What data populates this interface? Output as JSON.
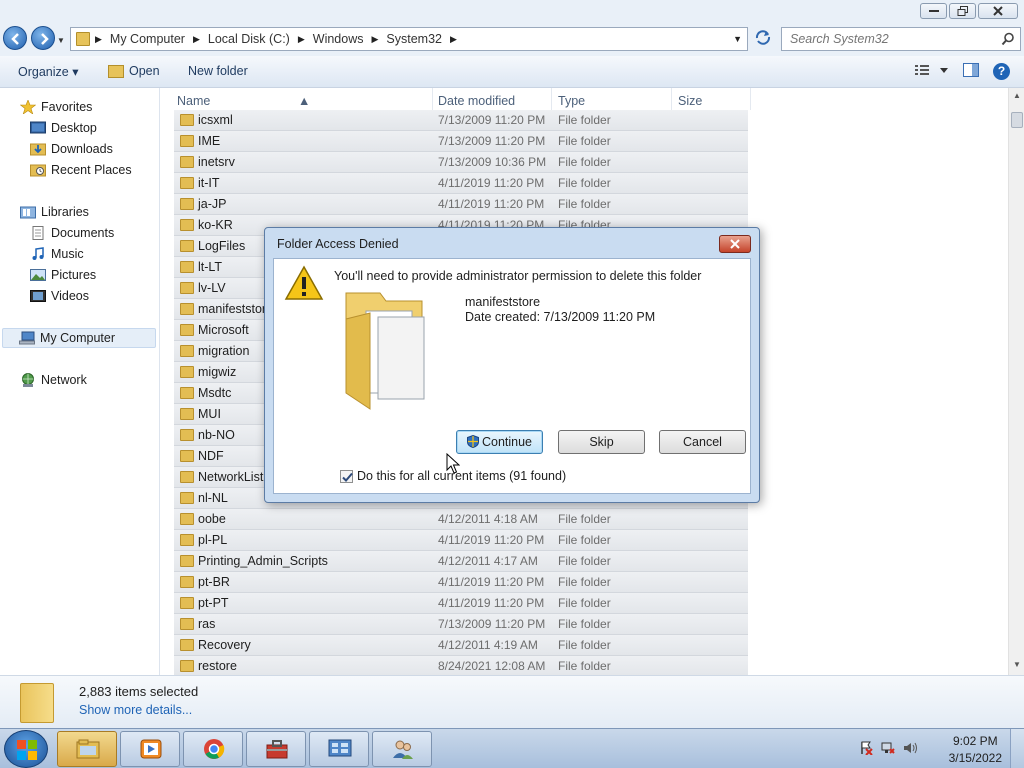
{
  "address": {
    "crumbs": [
      "My Computer",
      "Local Disk (C:)",
      "Windows",
      "System32"
    ],
    "search_placeholder": "Search System32"
  },
  "toolbar": {
    "organize": "Organize",
    "open": "Open",
    "new_folder": "New folder"
  },
  "nav": {
    "favorites": "Favorites",
    "desktop": "Desktop",
    "downloads": "Downloads",
    "recent": "Recent Places",
    "libraries": "Libraries",
    "documents": "Documents",
    "music": "Music",
    "pictures": "Pictures",
    "videos": "Videos",
    "computer": "My Computer",
    "network": "Network"
  },
  "columns": {
    "name": "Name",
    "date": "Date modified",
    "type": "Type",
    "size": "Size"
  },
  "files": [
    {
      "name": "icsxml",
      "date": "7/13/2009 11:20 PM",
      "type": "File folder"
    },
    {
      "name": "IME",
      "date": "7/13/2009 11:20 PM",
      "type": "File folder"
    },
    {
      "name": "inetsrv",
      "date": "7/13/2009 10:36 PM",
      "type": "File folder"
    },
    {
      "name": "it-IT",
      "date": "4/11/2019 11:20 PM",
      "type": "File folder"
    },
    {
      "name": "ja-JP",
      "date": "4/11/2019 11:20 PM",
      "type": "File folder"
    },
    {
      "name": "ko-KR",
      "date": "4/11/2019 11:20 PM",
      "type": "File folder"
    },
    {
      "name": "LogFiles",
      "date": "",
      "type": ""
    },
    {
      "name": "lt-LT",
      "date": "",
      "type": ""
    },
    {
      "name": "lv-LV",
      "date": "",
      "type": ""
    },
    {
      "name": "manifeststor",
      "date": "",
      "type": ""
    },
    {
      "name": "Microsoft",
      "date": "",
      "type": ""
    },
    {
      "name": "migration",
      "date": "",
      "type": ""
    },
    {
      "name": "migwiz",
      "date": "",
      "type": ""
    },
    {
      "name": "Msdtc",
      "date": "",
      "type": ""
    },
    {
      "name": "MUI",
      "date": "",
      "type": ""
    },
    {
      "name": "nb-NO",
      "date": "",
      "type": ""
    },
    {
      "name": "NDF",
      "date": "",
      "type": ""
    },
    {
      "name": "NetworkList",
      "date": "",
      "type": ""
    },
    {
      "name": "nl-NL",
      "date": "",
      "type": ""
    },
    {
      "name": "oobe",
      "date": "4/12/2011 4:18 AM",
      "type": "File folder"
    },
    {
      "name": "pl-PL",
      "date": "4/11/2019 11:20 PM",
      "type": "File folder"
    },
    {
      "name": "Printing_Admin_Scripts",
      "date": "4/12/2011 4:17 AM",
      "type": "File folder"
    },
    {
      "name": "pt-BR",
      "date": "4/11/2019 11:20 PM",
      "type": "File folder"
    },
    {
      "name": "pt-PT",
      "date": "4/11/2019 11:20 PM",
      "type": "File folder"
    },
    {
      "name": "ras",
      "date": "7/13/2009 11:20 PM",
      "type": "File folder"
    },
    {
      "name": "Recovery",
      "date": "4/12/2011 4:19 AM",
      "type": "File folder"
    },
    {
      "name": "restore",
      "date": "8/24/2021 12:08 AM",
      "type": "File folder"
    }
  ],
  "details": {
    "count": "2,883 items selected",
    "more": "Show more details..."
  },
  "dialog": {
    "title": "Folder Access Denied",
    "message": "You'll need to provide administrator permission to delete this folder",
    "file_name": "manifeststore",
    "file_date": "Date created: 7/13/2009 11:20 PM",
    "continue": "Continue",
    "skip": "Skip",
    "cancel": "Cancel",
    "checkbox_label": "Do this for all current items (91 found)",
    "checkbox_checked": true
  },
  "clock": {
    "time": "9:02 PM",
    "date": "3/15/2022"
  },
  "taskbar_apps": [
    "windows-explorer-icon",
    "media-player-icon",
    "chrome-icon",
    "toolbox-icon",
    "control-panel-icon",
    "users-icon"
  ]
}
